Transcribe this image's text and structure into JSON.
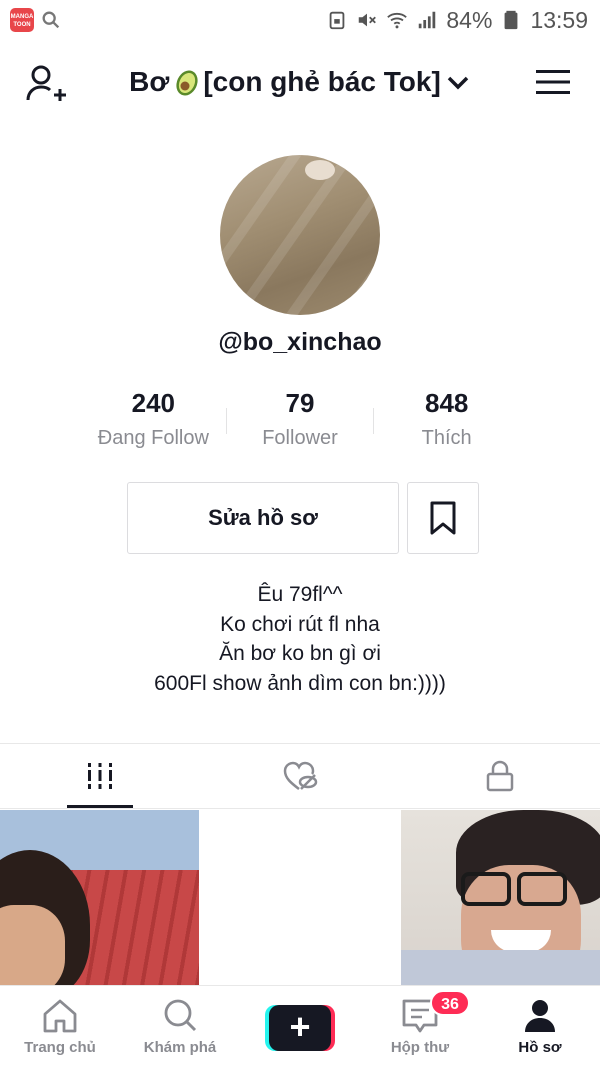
{
  "status_bar": {
    "app_badge": "MANGA TOON",
    "battery": "84%",
    "time": "13:59"
  },
  "header": {
    "title_part1": "Bơ",
    "title_part2": "[con ghẻ bác Tok]"
  },
  "profile": {
    "username": "@bo_xinchao",
    "stats": [
      {
        "value": "240",
        "label": "Đang Follow"
      },
      {
        "value": "79",
        "label": "Follower"
      },
      {
        "value": "848",
        "label": "Thích"
      }
    ],
    "edit_button": "Sửa hồ sơ",
    "bio": [
      "Êu 79fl^^",
      "Ko chơi rút fl nha",
      "Ăn bơ ko bn gì ơi",
      "600Fl show ảnh dìm con bn:))))"
    ]
  },
  "tabs": [
    "videos-grid-icon",
    "liked-hidden-icon",
    "lock-icon"
  ],
  "bottom_nav": {
    "home": "Trang chủ",
    "discover": "Khám phá",
    "inbox": "Hộp thư",
    "inbox_badge": "36",
    "profile": "Hồ sơ"
  }
}
